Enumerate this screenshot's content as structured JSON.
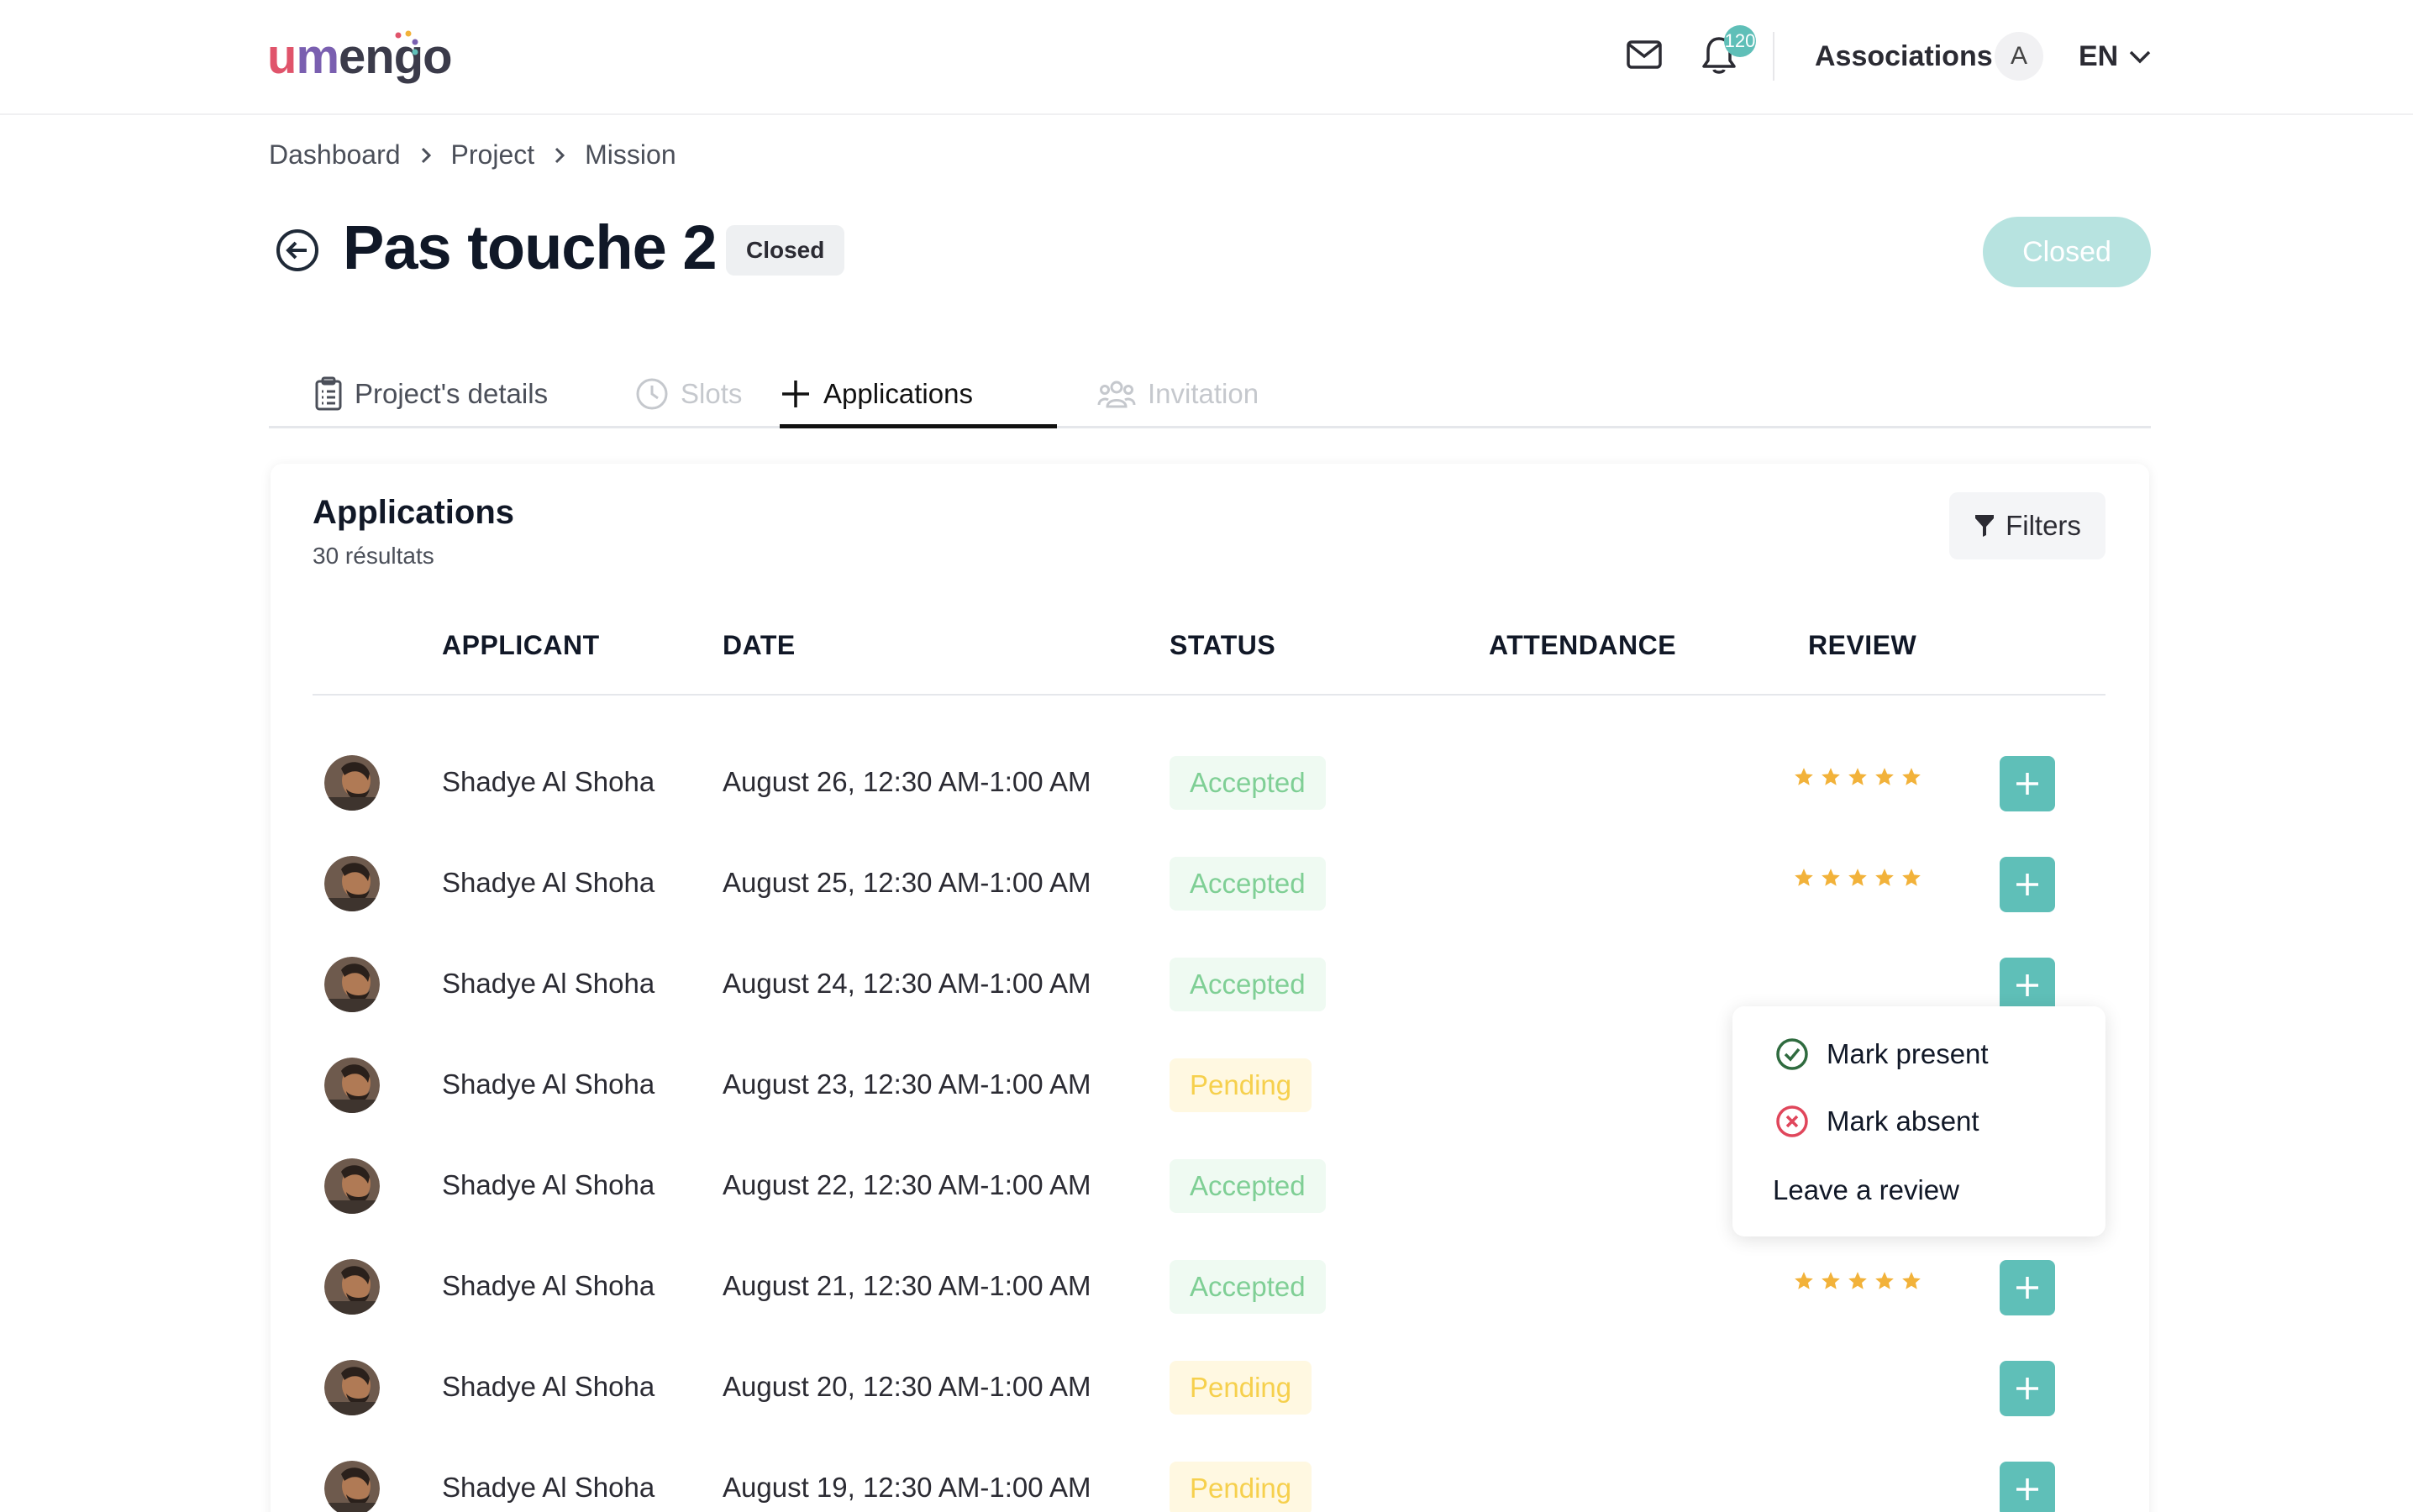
{
  "header": {
    "logo_text": "umengo",
    "notifications_count": "120",
    "account_label": "Associations",
    "avatar_initial": "A",
    "language": "EN"
  },
  "breadcrumb": [
    "Dashboard",
    "Project",
    "Mission"
  ],
  "page": {
    "title": "Pas touche 2",
    "status_chip": "Closed",
    "action_button": "Closed"
  },
  "tabs": [
    {
      "label": "Project's details",
      "icon": "clipboard-icon",
      "state": "normal"
    },
    {
      "label": "Slots",
      "icon": "clock-icon",
      "state": "disabled"
    },
    {
      "label": "Applications",
      "icon": "plus-icon",
      "state": "active"
    },
    {
      "label": "Invitation",
      "icon": "people-icon",
      "state": "disabled"
    }
  ],
  "applications": {
    "title": "Applications",
    "count_label": "30 résultats",
    "filters_label": "Filters",
    "columns": [
      "APPLICANT",
      "DATE",
      "STATUS",
      "ATTENDANCE",
      "REVIEW"
    ],
    "rows": [
      {
        "name": "Shadye Al Shoha",
        "date": "August 26, 12:30 AM-1:00 AM",
        "status": "Accepted",
        "stars": 5
      },
      {
        "name": "Shadye Al Shoha",
        "date": "August 25, 12:30 AM-1:00 AM",
        "status": "Accepted",
        "stars": 5
      },
      {
        "name": "Shadye Al Shoha",
        "date": "August 24, 12:30 AM-1:00 AM",
        "status": "Accepted",
        "stars": 0
      },
      {
        "name": "Shadye Al Shoha",
        "date": "August 23, 12:30 AM-1:00 AM",
        "status": "Pending",
        "stars": 0
      },
      {
        "name": "Shadye Al Shoha",
        "date": "August 22, 12:30 AM-1:00 AM",
        "status": "Accepted",
        "stars": 0
      },
      {
        "name": "Shadye Al Shoha",
        "date": "August 21, 12:30 AM-1:00 AM",
        "status": "Accepted",
        "stars": 5
      },
      {
        "name": "Shadye Al Shoha",
        "date": "August 20, 12:30 AM-1:00 AM",
        "status": "Pending",
        "stars": 0
      },
      {
        "name": "Shadye Al Shoha",
        "date": "August 19, 12:30 AM-1:00 AM",
        "status": "Pending",
        "stars": 0
      }
    ]
  },
  "row_menu": {
    "mark_present": "Mark present",
    "mark_absent": "Mark absent",
    "leave_review": "Leave a review"
  },
  "colors": {
    "teal": "#5fbfb8",
    "teal_light": "#b7e3e0",
    "star": "#f2b23a",
    "accepted_text": "#7fcf95",
    "pending_text": "#f6d04d"
  }
}
